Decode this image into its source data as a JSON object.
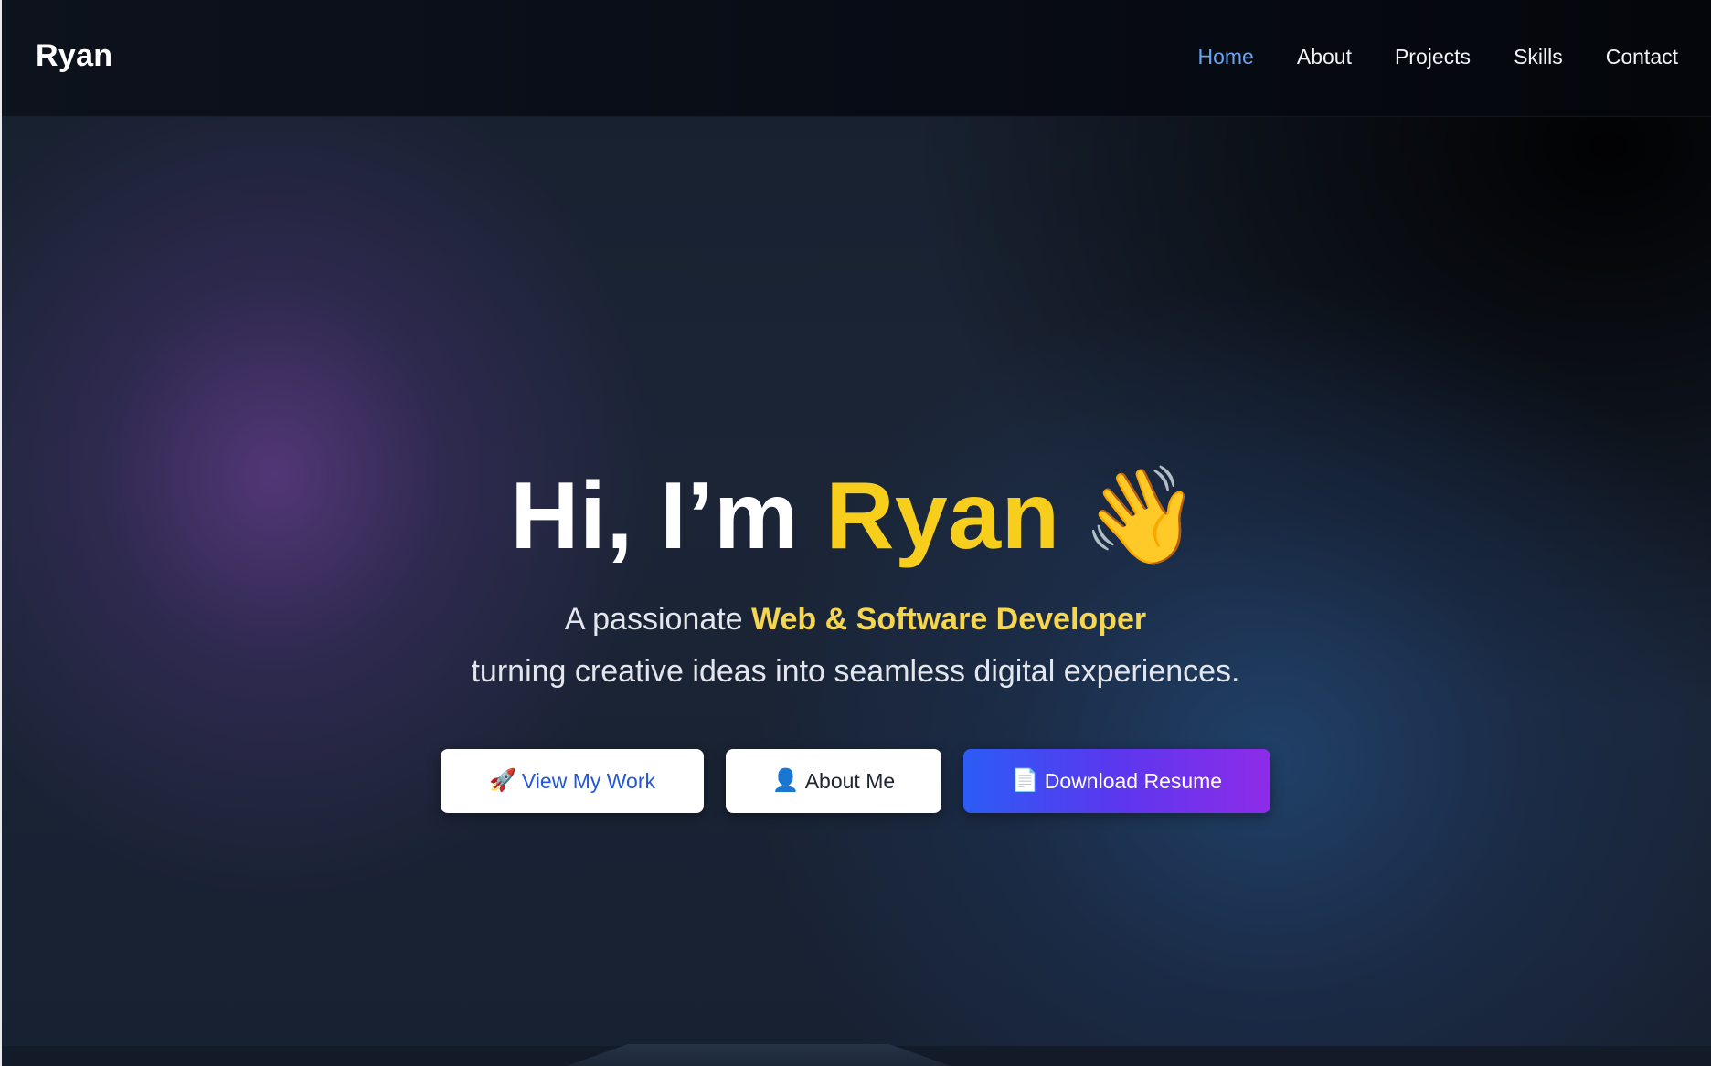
{
  "navbar": {
    "brand": "Ryan",
    "links": [
      {
        "label": "Home",
        "active": true
      },
      {
        "label": "About",
        "active": false
      },
      {
        "label": "Projects",
        "active": false
      },
      {
        "label": "Skills",
        "active": false
      },
      {
        "label": "Contact",
        "active": false
      }
    ]
  },
  "hero": {
    "greeting": "Hi, I’m ",
    "name": "Ryan",
    "wave_emoji": "👋",
    "tagline_prefix": "A passionate ",
    "tagline_highlight": "Web & Software Developer",
    "tagline_line2": "turning creative ideas into seamless digital experiences."
  },
  "buttons": {
    "view_work": {
      "icon": "🚀",
      "icon_name": "rocket-icon",
      "label": "View My Work"
    },
    "about_me": {
      "icon": "👤",
      "icon_name": "user-icon",
      "label": "About Me"
    },
    "download_resume": {
      "icon": "📄",
      "icon_name": "document-icon",
      "label": "Download Resume"
    }
  },
  "colors": {
    "accent_blue": "#6aa4f4",
    "name_yellow": "#f6ce1b",
    "highlight_yellow": "#f5d64e",
    "resume_gradient_start": "#2c5cf5",
    "resume_gradient_end": "#8e2ce8"
  }
}
